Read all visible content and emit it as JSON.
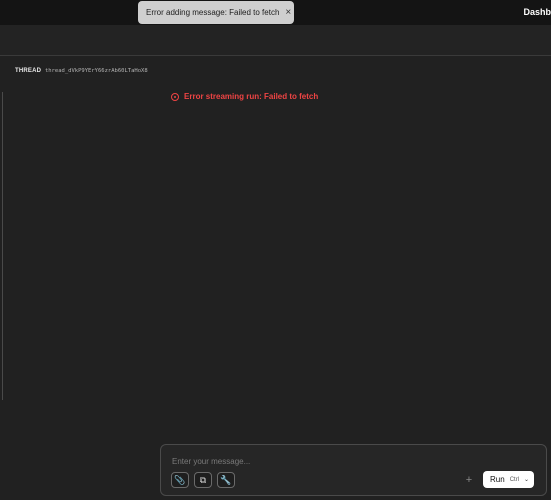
{
  "toast": {
    "message": "Error adding message: Failed to fetch",
    "close": "×"
  },
  "header": {
    "dashboard": "Dashb"
  },
  "thread": {
    "label": "THREAD",
    "id": "thread_dVkP9YErY66zrAb60LTaHoX8"
  },
  "error": {
    "message": "Error streaming run: Failed to fetch",
    "color": "#ef4444"
  },
  "composer": {
    "placeholder": "Enter your message...",
    "tools": {
      "attach": "📎",
      "copy": "⧉",
      "tools": "🔧"
    },
    "plus": "+",
    "run_label": "Run",
    "run_shortcut": "Ctrl",
    "run_chevron": "⌄"
  }
}
